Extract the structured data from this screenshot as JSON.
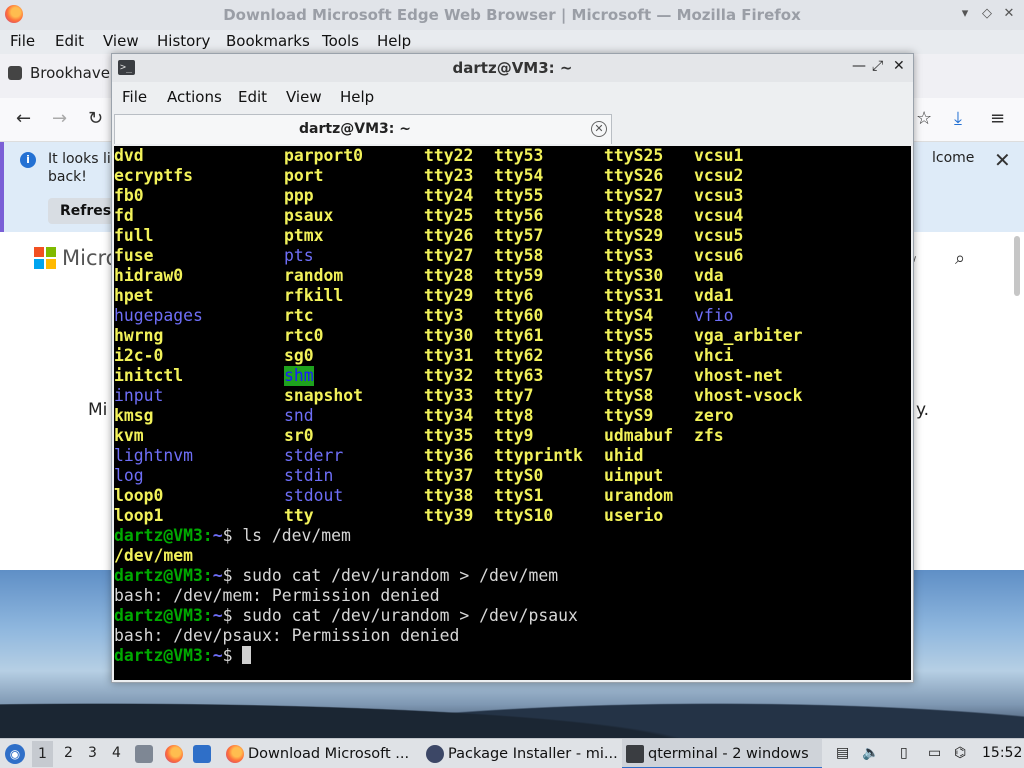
{
  "firefox": {
    "title": "Download Microsoft Edge Web Browser | Microsoft — Mozilla Firefox",
    "menu": [
      "File",
      "Edit",
      "View",
      "History",
      "Bookmarks",
      "Tools",
      "Help"
    ],
    "tab_title": "Brookhaven",
    "notification": {
      "message": "It looks lik back!",
      "refresh_label": "Refresh",
      "trailing_text": "lcome"
    },
    "page": {
      "brand_text": "Micro",
      "body_left": "Mi",
      "body_right": "y."
    }
  },
  "terminal": {
    "title": "dartz@VM3: ~",
    "menu": [
      "File",
      "Actions",
      "Edit",
      "View",
      "Help"
    ],
    "tab_title": "dartz@VM3: ~",
    "listing": [
      [
        [
          "dvd",
          "y"
        ],
        [
          "parport0",
          "y"
        ],
        [
          "tty22",
          "y"
        ],
        [
          "tty53",
          "y"
        ],
        [
          "ttyS25",
          "y"
        ],
        [
          "vcsu1",
          "y"
        ]
      ],
      [
        [
          "ecryptfs",
          "y"
        ],
        [
          "port",
          "y"
        ],
        [
          "tty23",
          "y"
        ],
        [
          "tty54",
          "y"
        ],
        [
          "ttyS26",
          "y"
        ],
        [
          "vcsu2",
          "y"
        ]
      ],
      [
        [
          "fb0",
          "y"
        ],
        [
          "ppp",
          "y"
        ],
        [
          "tty24",
          "y"
        ],
        [
          "tty55",
          "y"
        ],
        [
          "ttyS27",
          "y"
        ],
        [
          "vcsu3",
          "y"
        ]
      ],
      [
        [
          "fd",
          "y"
        ],
        [
          "psaux",
          "y"
        ],
        [
          "tty25",
          "y"
        ],
        [
          "tty56",
          "y"
        ],
        [
          "ttyS28",
          "y"
        ],
        [
          "vcsu4",
          "y"
        ]
      ],
      [
        [
          "full",
          "y"
        ],
        [
          "ptmx",
          "y"
        ],
        [
          "tty26",
          "y"
        ],
        [
          "tty57",
          "y"
        ],
        [
          "ttyS29",
          "y"
        ],
        [
          "vcsu5",
          "y"
        ]
      ],
      [
        [
          "fuse",
          "y"
        ],
        [
          "pts",
          "b"
        ],
        [
          "tty27",
          "y"
        ],
        [
          "tty58",
          "y"
        ],
        [
          "ttyS3",
          "y"
        ],
        [
          "vcsu6",
          "y"
        ]
      ],
      [
        [
          "hidraw0",
          "y"
        ],
        [
          "random",
          "y"
        ],
        [
          "tty28",
          "y"
        ],
        [
          "tty59",
          "y"
        ],
        [
          "ttyS30",
          "y"
        ],
        [
          "vda",
          "y"
        ]
      ],
      [
        [
          "hpet",
          "y"
        ],
        [
          "rfkill",
          "y"
        ],
        [
          "tty29",
          "y"
        ],
        [
          "tty6",
          "y"
        ],
        [
          "ttyS31",
          "y"
        ],
        [
          "vda1",
          "y"
        ]
      ],
      [
        [
          "hugepages",
          "b"
        ],
        [
          "rtc",
          "y"
        ],
        [
          "tty3",
          "y"
        ],
        [
          "tty60",
          "y"
        ],
        [
          "ttyS4",
          "y"
        ],
        [
          "vfio",
          "b"
        ]
      ],
      [
        [
          "hwrng",
          "y"
        ],
        [
          "rtc0",
          "y"
        ],
        [
          "tty30",
          "y"
        ],
        [
          "tty61",
          "y"
        ],
        [
          "ttyS5",
          "y"
        ],
        [
          "vga_arbiter",
          "y"
        ]
      ],
      [
        [
          "i2c-0",
          "y"
        ],
        [
          "sg0",
          "y"
        ],
        [
          "tty31",
          "y"
        ],
        [
          "tty62",
          "y"
        ],
        [
          "ttyS6",
          "y"
        ],
        [
          "vhci",
          "y"
        ]
      ],
      [
        [
          "initctl",
          "y"
        ],
        [
          "shm",
          "shm"
        ],
        [
          "tty32",
          "y"
        ],
        [
          "tty63",
          "y"
        ],
        [
          "ttyS7",
          "y"
        ],
        [
          "vhost-net",
          "y"
        ]
      ],
      [
        [
          "input",
          "b"
        ],
        [
          "snapshot",
          "y"
        ],
        [
          "tty33",
          "y"
        ],
        [
          "tty7",
          "y"
        ],
        [
          "ttyS8",
          "y"
        ],
        [
          "vhost-vsock",
          "y"
        ]
      ],
      [
        [
          "kmsg",
          "y"
        ],
        [
          "snd",
          "b"
        ],
        [
          "tty34",
          "y"
        ],
        [
          "tty8",
          "y"
        ],
        [
          "ttyS9",
          "y"
        ],
        [
          "zero",
          "y"
        ]
      ],
      [
        [
          "kvm",
          "y"
        ],
        [
          "sr0",
          "y"
        ],
        [
          "tty35",
          "y"
        ],
        [
          "tty9",
          "y"
        ],
        [
          "udmabuf",
          "y"
        ],
        [
          "zfs",
          "y"
        ]
      ],
      [
        [
          "lightnvm",
          "b"
        ],
        [
          "stderr",
          "b"
        ],
        [
          "tty36",
          "y"
        ],
        [
          "ttyprintk",
          "y"
        ],
        [
          "uhid",
          "y"
        ],
        [
          "",
          ""
        ]
      ],
      [
        [
          "log",
          "b"
        ],
        [
          "stdin",
          "b"
        ],
        [
          "tty37",
          "y"
        ],
        [
          "ttyS0",
          "y"
        ],
        [
          "uinput",
          "y"
        ],
        [
          "",
          ""
        ]
      ],
      [
        [
          "loop0",
          "y"
        ],
        [
          "stdout",
          "b"
        ],
        [
          "tty38",
          "y"
        ],
        [
          "ttyS1",
          "y"
        ],
        [
          "urandom",
          "y"
        ],
        [
          "",
          ""
        ]
      ],
      [
        [
          "loop1",
          "y"
        ],
        [
          "tty",
          "y"
        ],
        [
          "tty39",
          "y"
        ],
        [
          "ttyS10",
          "y"
        ],
        [
          "userio",
          "y"
        ],
        [
          "",
          ""
        ]
      ]
    ],
    "prompt_user": "dartz@VM3:",
    "prompt_path": "~",
    "prompt_sign": "$ ",
    "session": [
      {
        "type": "cmd",
        "text": "ls /dev/mem"
      },
      {
        "type": "out_yellow",
        "text": "/dev/mem"
      },
      {
        "type": "cmd",
        "text": "sudo cat /dev/urandom > /dev/mem"
      },
      {
        "type": "out",
        "text": "bash: /dev/mem: Permission denied"
      },
      {
        "type": "cmd",
        "text": "sudo cat /dev/urandom > /dev/psaux"
      },
      {
        "type": "out",
        "text": "bash: /dev/psaux: Permission denied"
      },
      {
        "type": "prompt",
        "text": ""
      }
    ]
  },
  "taskbar": {
    "workspaces": [
      "1",
      "2",
      "3",
      "4"
    ],
    "tasks": [
      {
        "label": "Download Microsoft ..."
      },
      {
        "label": "Package Installer - mi..."
      },
      {
        "label": "qterminal - 2 windows"
      }
    ],
    "clock": "15:52"
  },
  "colors": {
    "term_yellow": "#f2f25a",
    "term_blue": "#6e6ef6",
    "term_green": "#00aa00",
    "shm_bg": "#1ea21e"
  }
}
